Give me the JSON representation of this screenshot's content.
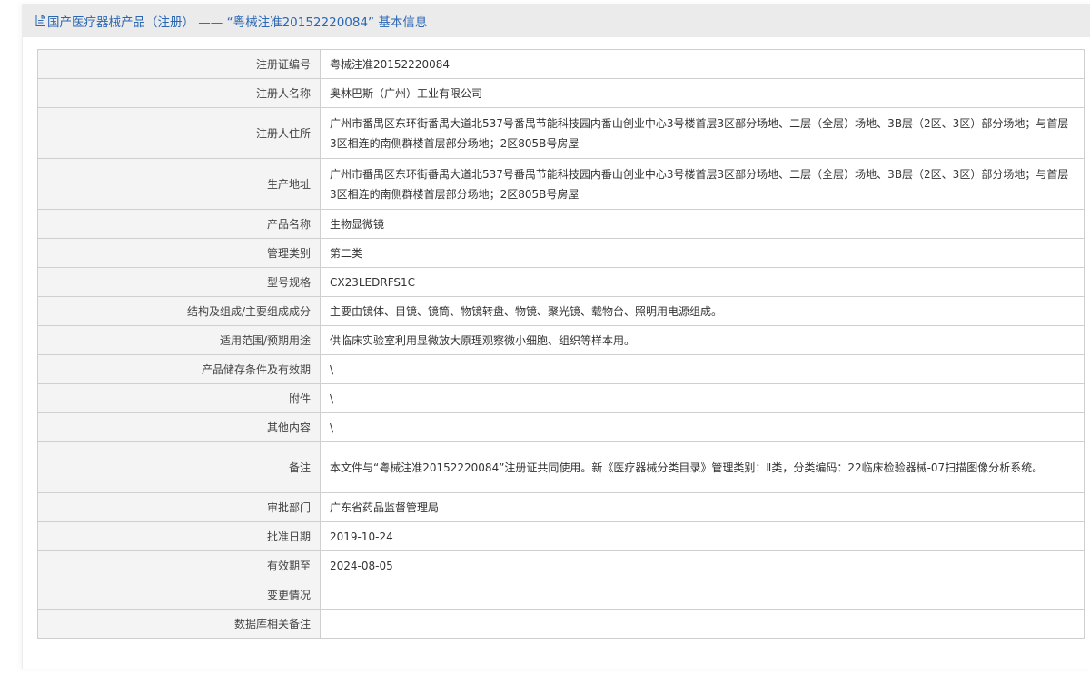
{
  "header": {
    "icon": "document-icon",
    "title": "国产医疗器械产品（注册） —— “粤械注准20152220084” 基本信息"
  },
  "rows": [
    {
      "label": "注册证编号",
      "value": "粤械注准20152220084"
    },
    {
      "label": "注册人名称",
      "value": "奥林巴斯（广州）工业有限公司"
    },
    {
      "label": "注册人住所",
      "value": "广州市番禺区东环街番禺大道北537号番禺节能科技园内番山创业中心3号楼首层3区部分场地、二层（全层）场地、3B层（2区、3区）部分场地；与首层3区相连的南侧群楼首层部分场地；2区805B号房屋"
    },
    {
      "label": "生产地址",
      "value": "广州市番禺区东环街番禺大道北537号番禺节能科技园内番山创业中心3号楼首层3区部分场地、二层（全层）场地、3B层（2区、3区）部分场地；与首层3区相连的南侧群楼首层部分场地；2区805B号房屋"
    },
    {
      "label": "产品名称",
      "value": "生物显微镜"
    },
    {
      "label": "管理类别",
      "value": "第二类"
    },
    {
      "label": "型号规格",
      "value": "CX23LEDRFS1C"
    },
    {
      "label": "结构及组成/主要组成成分",
      "value": "主要由镜体、目镜、镜筒、物镜转盘、物镜、聚光镜、载物台、照明用电源组成。"
    },
    {
      "label": "适用范围/预期用途",
      "value": "供临床实验室利用显微放大原理观察微小细胞、组织等样本用。"
    },
    {
      "label": "产品储存条件及有效期",
      "value": "\\"
    },
    {
      "label": "附件",
      "value": "\\"
    },
    {
      "label": "其他内容",
      "value": "\\"
    },
    {
      "label": "备注",
      "value": "本文件与“粤械注准20152220084”注册证共同使用。新《医疗器械分类目录》管理类别：Ⅱ类，分类编码：22临床检验器械-07扫描图像分析系统。"
    },
    {
      "label": "审批部门",
      "value": "广东省药品监督管理局"
    },
    {
      "label": "批准日期",
      "value": "2019-10-24"
    },
    {
      "label": "有效期至",
      "value": "2024-08-05"
    },
    {
      "label": "变更情况",
      "value": ""
    },
    {
      "label": "数据库相关备注",
      "value": ""
    }
  ]
}
